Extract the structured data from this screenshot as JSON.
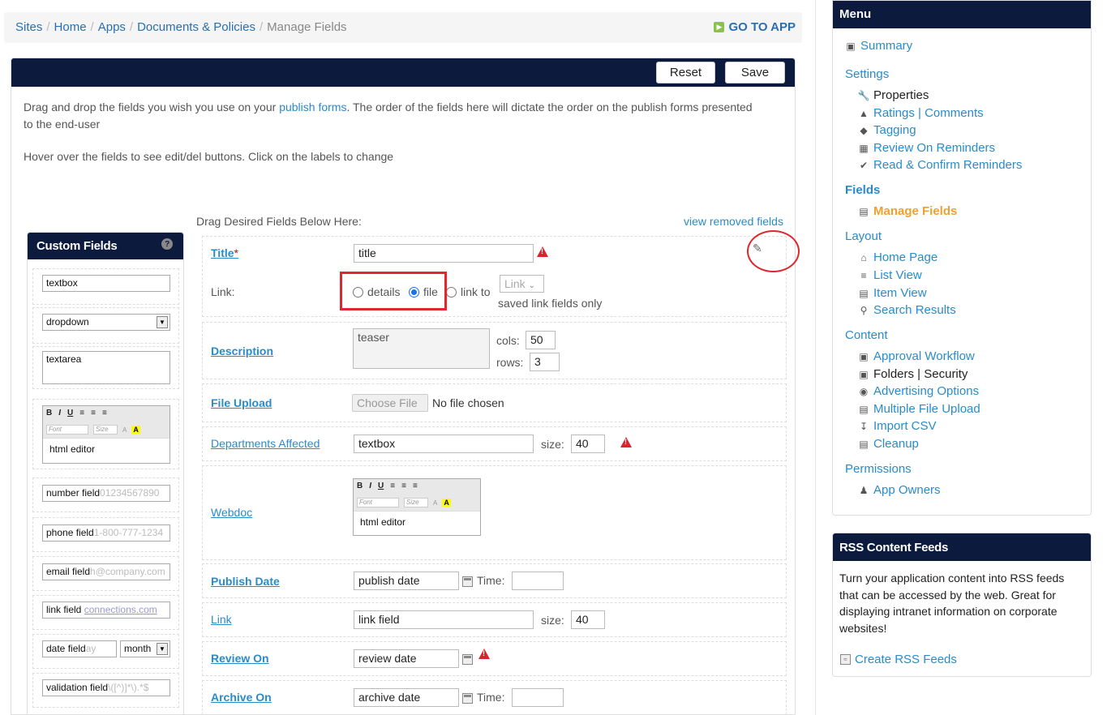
{
  "breadcrumb": {
    "items": [
      "Sites",
      "Home",
      "Apps",
      "Documents & Policies"
    ],
    "current": "Manage Fields",
    "go_to_app": "GO TO APP"
  },
  "toolbar": {
    "reset": "Reset",
    "save": "Save"
  },
  "intro": {
    "line1_pre": "Drag and drop the fields you wish you use on your ",
    "line1_link": "publish forms",
    "line1_post": ". The order of the fields here will dictate the order on the publish forms presented to the end-user",
    "line2": "Hover over the fields to see edit/del buttons. Click on the labels to change"
  },
  "custom_fields": {
    "title": "Custom Fields",
    "help": "?",
    "textbox": "textbox",
    "dropdown": "dropdown",
    "textarea": "textarea",
    "editor": {
      "b": "B",
      "i": "I",
      "u": "U",
      "font": "Font",
      "size": "Size",
      "text": "html editor"
    },
    "number": {
      "label": "number field",
      "placeholder": "01234567890"
    },
    "phone": {
      "label": "phone field",
      "placeholder": "1-800-777-1234"
    },
    "email": {
      "label": "email field",
      "placeholder": "h@company.com"
    },
    "link": {
      "label": "link field",
      "placeholder": "connections.com"
    },
    "date": {
      "label": "date field",
      "placeholder": "ay",
      "select": "month"
    },
    "validation": {
      "label": "validation field",
      "placeholder": "\\([^)]*\\).*$"
    }
  },
  "drag": {
    "label": "Drag Desired Fields Below Here:",
    "view_removed": "view removed fields"
  },
  "fields": {
    "title": {
      "label": "Title",
      "req": "*",
      "value": "title",
      "link_label": "Link:",
      "opt_details": "details",
      "opt_file": "file",
      "opt_linkto": "link to",
      "link_select": "Link",
      "saved_note": "saved link fields only"
    },
    "description": {
      "label": "Description",
      "value": "teaser",
      "cols_label": "cols:",
      "cols": "50",
      "rows_label": "rows:",
      "rows": "3"
    },
    "file_upload": {
      "label": "File Upload",
      "button": "Choose File",
      "status": "No file chosen"
    },
    "departments": {
      "label": "Departments Affected",
      "value": "textbox",
      "size_label": "size:",
      "size": "40"
    },
    "webdoc": {
      "label": "Webdoc",
      "b": "B",
      "i": "I",
      "u": "U",
      "font": "Font",
      "size": "Size",
      "text": "html editor"
    },
    "publish_date": {
      "label": "Publish Date",
      "value": "publish date",
      "time_label": "Time:"
    },
    "link": {
      "label": "Link",
      "value": "link field",
      "size_label": "size:",
      "size": "40"
    },
    "review_on": {
      "label": "Review On",
      "value": "review date"
    },
    "archive_on": {
      "label": "Archive On",
      "value": "archive date",
      "time_label": "Time:"
    }
  },
  "menu": {
    "title": "Menu",
    "summary": "Summary",
    "settings": "Settings",
    "properties": "Properties",
    "ratings": "Ratings | Comments",
    "tagging": "Tagging",
    "review_reminders": "Review On Reminders",
    "read_confirm": "Read & Confirm Reminders",
    "fields": "Fields",
    "manage_fields": "Manage Fields",
    "layout": "Layout",
    "home_page": "Home Page",
    "list_view": "List View",
    "item_view": "Item View",
    "search_results": "Search Results",
    "content": "Content",
    "approval_workflow": "Approval Workflow",
    "folders_security": "Folders | Security",
    "advertising": "Advertising Options",
    "multiple_upload": "Multiple File Upload",
    "import_csv": "Import CSV",
    "cleanup": "Cleanup",
    "permissions": "Permissions",
    "app_owners": "App Owners"
  },
  "rss": {
    "title": "RSS Content Feeds",
    "text": "Turn your application content into RSS feeds that can be accessed by the web. Great for displaying intranet information on corporate websites!",
    "link": "Create RSS Feeds"
  },
  "colors": {
    "header": "#0c1a3e",
    "link": "#2a8bc9",
    "active": "#f0a030",
    "warning": "#d9232d",
    "highlight": "#e0262e"
  }
}
